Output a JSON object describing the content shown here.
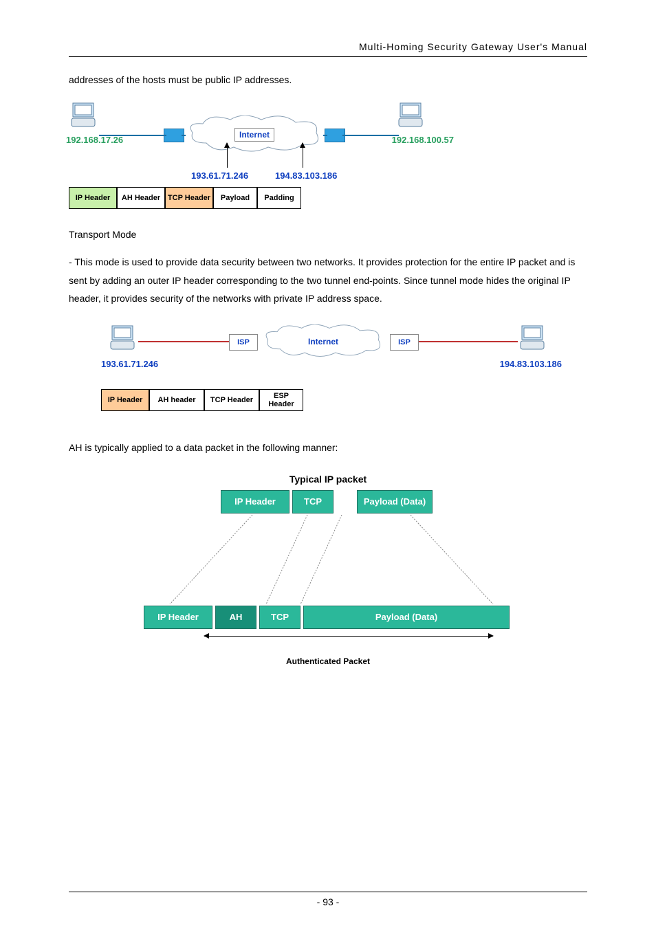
{
  "header": {
    "title": "Multi-Homing Security Gateway User's Manual"
  },
  "intro": {
    "line": "addresses of the hosts must be public IP addresses."
  },
  "diagram1": {
    "left_ip": "192.168.17.26",
    "right_ip": "192.168.100.57",
    "cloud_label": "Internet",
    "arrow_left_ip": "193.61.71.246",
    "arrow_right_ip": "194.83.103.186",
    "packet": {
      "cells": [
        {
          "text": "IP Header",
          "cls": "bg-lime small"
        },
        {
          "text": "AH Header",
          "cls": " small"
        },
        {
          "text": "TCP Header",
          "cls": "bg-peach small"
        },
        {
          "text": "Payload",
          "cls": " med"
        },
        {
          "text": "Padding",
          "cls": " med"
        }
      ]
    }
  },
  "transport": {
    "heading": "Transport Mode",
    "para": "- This mode is used to provide data security between two networks. It provides protection for the entire IP packet and is sent by adding an outer IP header corresponding to the two tunnel end-points. Since tunnel mode hides the original IP header, it provides security of the networks with private IP address space."
  },
  "diagram2": {
    "left_ip": "193.61.71.246",
    "right_ip": "194.83.103.186",
    "isp_label": "ISP",
    "cloud_label": "Internet",
    "packet": {
      "cells": [
        {
          "text": "IP Header",
          "cls": "bg-peach small"
        },
        {
          "text": "AH header",
          "cls": " big"
        },
        {
          "text": "TCP Header",
          "cls": " big"
        },
        {
          "text": "ESP Header",
          "cls": " med"
        }
      ]
    }
  },
  "ah_line": "AH is typically applied to a data packet in the following manner:",
  "diagram3": {
    "caption": "Typical IP packet",
    "top": [
      "IP Header",
      "TCP",
      "Payload (Data)"
    ],
    "bottom": [
      "IP Header",
      "AH",
      "TCP",
      "Payload (Data)"
    ],
    "auth_label": "Authenticated Packet"
  },
  "footer": {
    "page": "- 93 -"
  }
}
